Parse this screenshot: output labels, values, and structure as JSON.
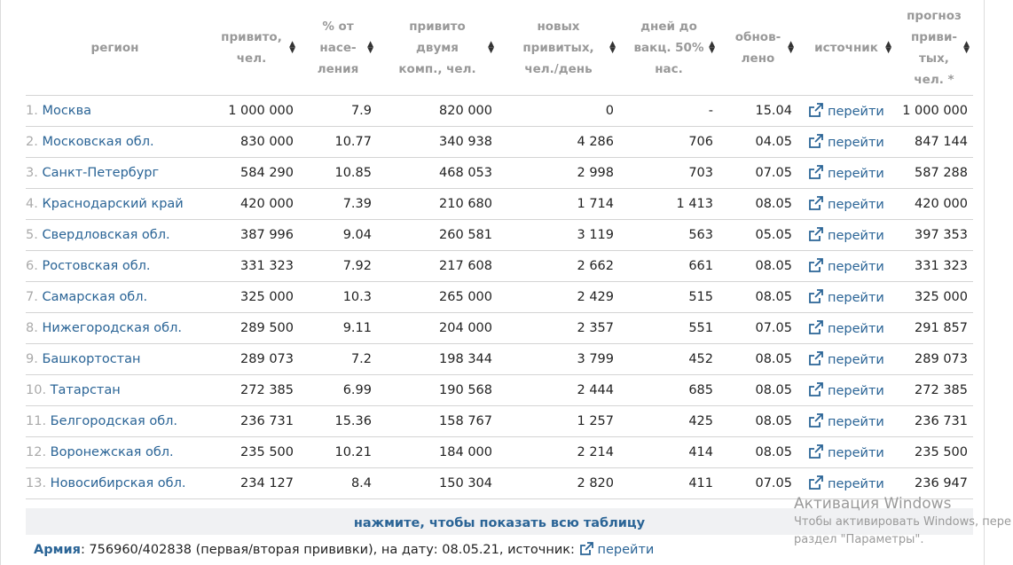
{
  "table": {
    "headers": [
      {
        "lines": [
          "регион"
        ]
      },
      {
        "lines": [
          "привито,",
          "чел."
        ]
      },
      {
        "lines": [
          "% от",
          "насе-",
          "ления"
        ]
      },
      {
        "lines": [
          "привито",
          "двумя",
          "комп., чел."
        ]
      },
      {
        "lines": [
          "новых",
          "привитых,",
          "чел./день"
        ]
      },
      {
        "lines": [
          "дней до",
          "вакц. 50%",
          "нас."
        ]
      },
      {
        "lines": [
          "обнов-",
          "лено"
        ]
      },
      {
        "lines": [
          "источник"
        ]
      },
      {
        "lines": [
          "прогноз",
          "приви-",
          "тых,",
          "чел. *"
        ]
      }
    ],
    "rows": [
      {
        "num": "1.",
        "region": "Москва",
        "vaccinated": "1 000 000",
        "pct": "7.9",
        "two": "820 000",
        "perday": "0",
        "days": "-",
        "updated": "15.04",
        "source": "перейти",
        "forecast": "1 000 000"
      },
      {
        "num": "2.",
        "region": "Московская обл.",
        "vaccinated": "830 000",
        "pct": "10.77",
        "two": "340 938",
        "perday": "4 286",
        "days": "706",
        "updated": "04.05",
        "source": "перейти",
        "forecast": "847 144"
      },
      {
        "num": "3.",
        "region": "Санкт-Петербург",
        "vaccinated": "584 290",
        "pct": "10.85",
        "two": "468 053",
        "perday": "2 998",
        "days": "703",
        "updated": "07.05",
        "source": "перейти",
        "forecast": "587 288"
      },
      {
        "num": "4.",
        "region": "Краснодарский край",
        "vaccinated": "420 000",
        "pct": "7.39",
        "two": "210 680",
        "perday": "1 714",
        "days": "1 413",
        "updated": "08.05",
        "source": "перейти",
        "forecast": "420 000"
      },
      {
        "num": "5.",
        "region": "Свердловская обл.",
        "vaccinated": "387 996",
        "pct": "9.04",
        "two": "260 581",
        "perday": "3 119",
        "days": "563",
        "updated": "05.05",
        "source": "перейти",
        "forecast": "397 353"
      },
      {
        "num": "6.",
        "region": "Ростовская обл.",
        "vaccinated": "331 323",
        "pct": "7.92",
        "two": "217 608",
        "perday": "2 662",
        "days": "661",
        "updated": "08.05",
        "source": "перейти",
        "forecast": "331 323"
      },
      {
        "num": "7.",
        "region": "Самарская обл.",
        "vaccinated": "325 000",
        "pct": "10.3",
        "two": "265 000",
        "perday": "2 429",
        "days": "515",
        "updated": "08.05",
        "source": "перейти",
        "forecast": "325 000"
      },
      {
        "num": "8.",
        "region": "Нижегородская обл.",
        "vaccinated": "289 500",
        "pct": "9.11",
        "two": "204 000",
        "perday": "2 357",
        "days": "551",
        "updated": "07.05",
        "source": "перейти",
        "forecast": "291 857"
      },
      {
        "num": "9.",
        "region": "Башкортостан",
        "vaccinated": "289 073",
        "pct": "7.2",
        "two": "198 344",
        "perday": "3 799",
        "days": "452",
        "updated": "08.05",
        "source": "перейти",
        "forecast": "289 073"
      },
      {
        "num": "10.",
        "region": "Татарстан",
        "vaccinated": "272 385",
        "pct": "6.99",
        "two": "190 568",
        "perday": "2 444",
        "days": "685",
        "updated": "08.05",
        "source": "перейти",
        "forecast": "272 385"
      },
      {
        "num": "11.",
        "region": "Белгородская обл.",
        "vaccinated": "236 731",
        "pct": "15.36",
        "two": "158 767",
        "perday": "1 257",
        "days": "425",
        "updated": "08.05",
        "source": "перейти",
        "forecast": "236 731"
      },
      {
        "num": "12.",
        "region": "Воронежская обл.",
        "vaccinated": "235 500",
        "pct": "10.21",
        "two": "184 000",
        "perday": "2 214",
        "days": "414",
        "updated": "08.05",
        "source": "перейти",
        "forecast": "235 500"
      },
      {
        "num": "13.",
        "region": "Новосибирская обл.",
        "vaccinated": "234 127",
        "pct": "8.4",
        "two": "150 304",
        "perday": "2 820",
        "days": "411",
        "updated": "07.05",
        "source": "перейти",
        "forecast": "236 947"
      }
    ]
  },
  "show_all": "нажмите, чтобы показать всю таблицу",
  "army": {
    "label": "Армия",
    "text": ": 756960/402838 (первая/вторая прививки), на дату: 08.05.21, источник:",
    "link": "перейти"
  },
  "windows_watermark": {
    "title": "Активация Windows",
    "line1": "Чтобы активировать Windows, пере",
    "line2": "раздел \"Параметры\"."
  },
  "colors": {
    "link": "#2a6496",
    "header_text": "#999999",
    "row_border": "#d4d4d4",
    "show_all_bg": "#f0f1f3"
  },
  "icons": {
    "external_link": "external-link-icon",
    "sort": "sort-icon"
  }
}
